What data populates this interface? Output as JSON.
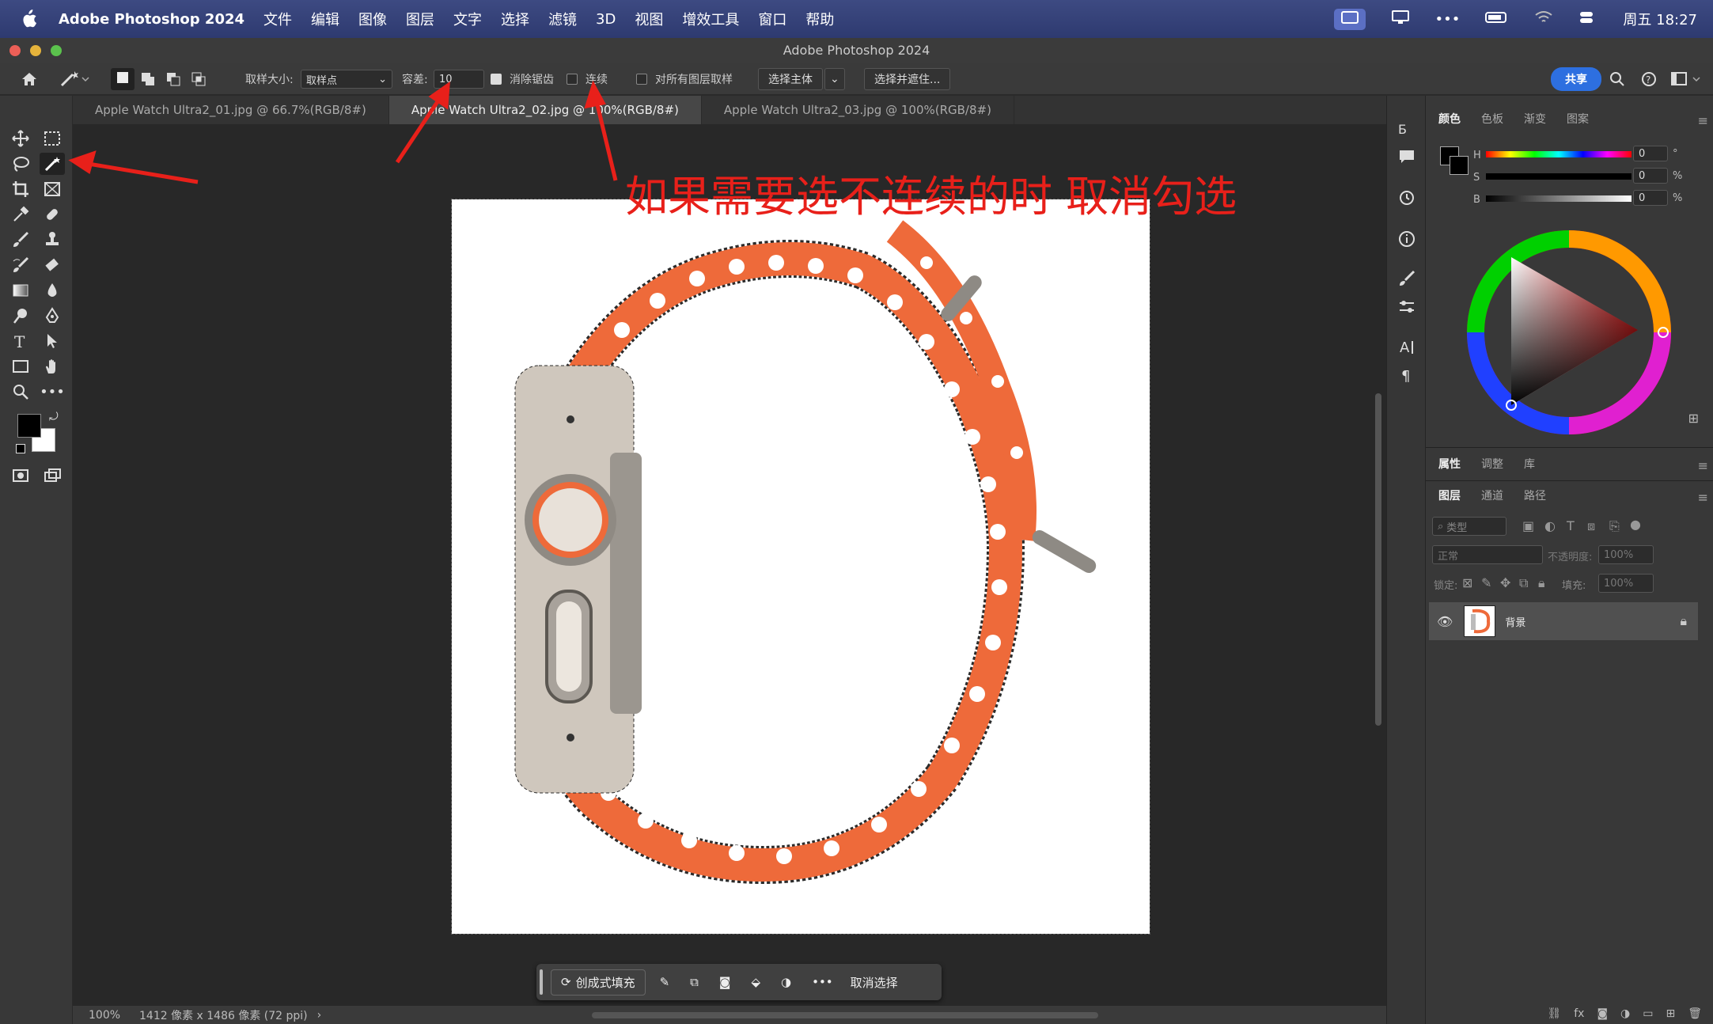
{
  "menubar": {
    "app": "Adobe Photoshop 2024",
    "items": [
      "文件",
      "编辑",
      "图像",
      "图层",
      "文字",
      "选择",
      "滤镜",
      "3D",
      "视图",
      "增效工具",
      "窗口",
      "帮助"
    ],
    "clock": "周五 18:27"
  },
  "window": {
    "title": "Adobe Photoshop 2024"
  },
  "options": {
    "sample_size_label": "取样大小:",
    "sample_size_value": "取样点",
    "tolerance_label": "容差:",
    "tolerance_value": "10",
    "antialias_label": "消除锯齿",
    "antialias_checked": true,
    "contiguous_label": "连续",
    "contiguous_checked": false,
    "all_layers_label": "对所有图层取样",
    "all_layers_checked": false,
    "select_subject": "选择主体",
    "select_mask": "选择并遮住...",
    "share": "共享"
  },
  "tabs": [
    {
      "label": "Apple Watch Ultra2_01.jpg @ 66.7%(RGB/8#)"
    },
    {
      "label": "Apple Watch Ultra2_02.jpg @ 100%(RGB/8#)",
      "active": true
    },
    {
      "label": "Apple Watch Ultra2_03.jpg @ 100%(RGB/8#)"
    }
  ],
  "annotation": "如果需要选不连续的时 取消勾选",
  "status": {
    "zoom": "100%",
    "info": "1412 像素 x 1486 像素 (72 ppi)"
  },
  "contextbar": {
    "gen_fill": "创成式填充",
    "deselect": "取消选择"
  },
  "color_panel": {
    "tabs": [
      "颜色",
      "色板",
      "渐变",
      "图案"
    ],
    "h_label": "H",
    "s_label": "S",
    "b_label": "B",
    "h_value": "0",
    "s_value": "0",
    "b_value": "0",
    "h_unit": "°",
    "s_unit": "%",
    "b_unit": "%"
  },
  "props_panel": {
    "tabs": [
      "属性",
      "调整",
      "库"
    ]
  },
  "layers_panel": {
    "tabs": [
      "图层",
      "通道",
      "路径"
    ],
    "kind_placeholder": "类型",
    "blend_mode": "正常",
    "opacity_label": "不透明度:",
    "opacity_value": "100%",
    "lock_label": "锁定:",
    "fill_label": "填充:",
    "fill_value": "100%",
    "layer_name": "背景"
  },
  "colors": {
    "accent": "#2d6fe0",
    "annotation": "#e8201a",
    "band": "#ee6a3a"
  }
}
